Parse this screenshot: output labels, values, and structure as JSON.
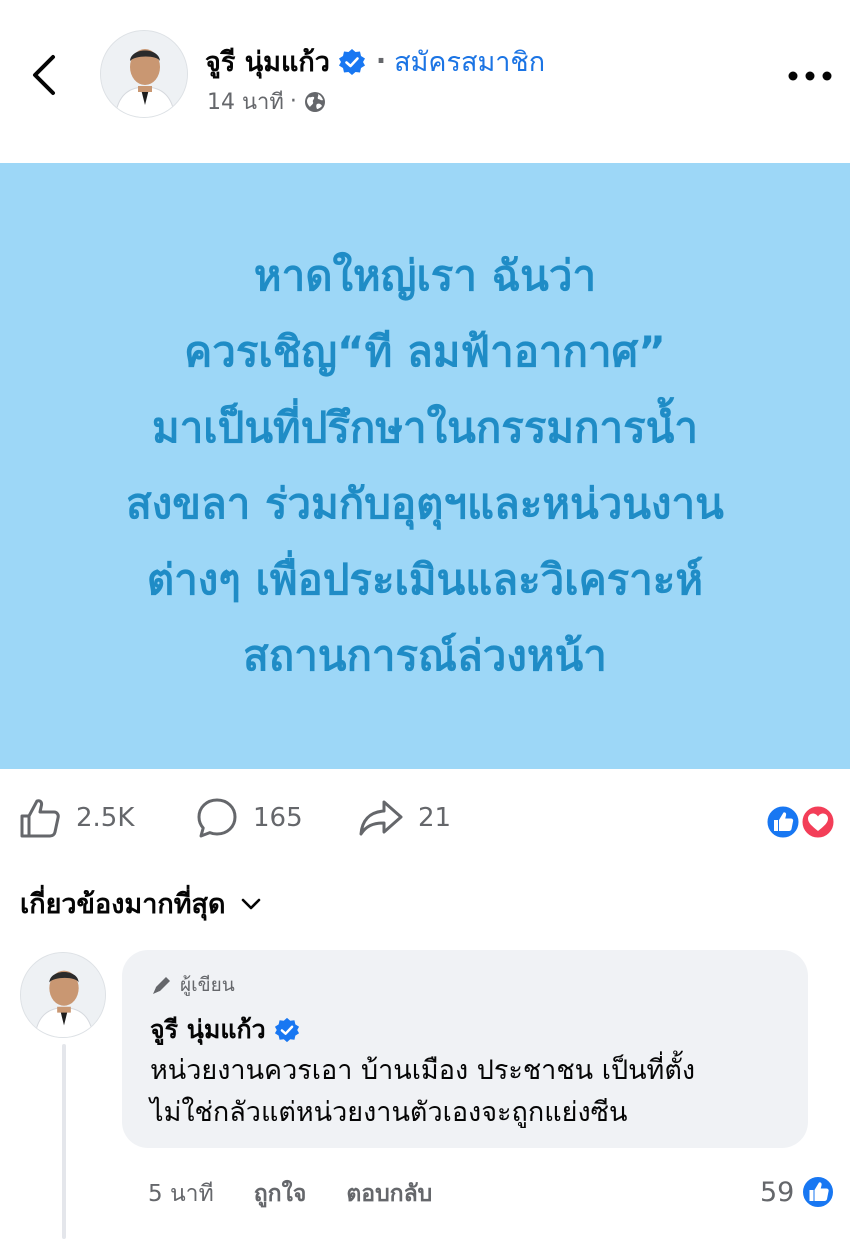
{
  "header": {
    "author_name": "จูรี นุ่มแก้ว",
    "separator": "·",
    "join_label": "สมัครสมาชิก",
    "time": "14 นาที",
    "meta_dot": "·",
    "back_icon": "chevron-left-icon",
    "more_icon": "more-horizontal-icon",
    "privacy_icon": "globe-icon"
  },
  "post": {
    "background": "#9dd7f7",
    "text_color": "#1f8cc6",
    "lines": [
      "หาดใหญ่เรา ฉันว่า",
      "ควรเชิญ“ที ลมฟ้าอากาศ”",
      "มาเป็นที่ปรึกษาในกรรมการน้ำ",
      "สงขลา ร่วมกับอุตุฯและหน่วนงาน",
      "ต่างๆ เพื่อประเมินและวิเคราะห์",
      "สถานการณ์ล่วงหน้า"
    ]
  },
  "actions": {
    "likes": "2.5K",
    "comments": "165",
    "shares": "21"
  },
  "comments_section": {
    "sort_label": "เกี่ยวข้องมากที่สุด",
    "comment": {
      "badge": "ผู้เขียน",
      "name": "จูรี นุ่มแก้ว",
      "line1": "หน่วยงานควรเอา บ้านเมือง ประชาชน เป็นที่ตั้ง",
      "line2": "ไม่ใช่กลัวแต่หน่วยงานตัวเองจะถูกแย่งซีน",
      "time": "5 นาที",
      "like_label": "ถูกใจ",
      "reply_label": "ตอบกลับ",
      "like_count": "59"
    }
  },
  "colors": {
    "link_blue": "#1b74e4",
    "verified_blue": "#1877f2",
    "love_red": "#f33e58",
    "secondary_text": "#65676b"
  }
}
